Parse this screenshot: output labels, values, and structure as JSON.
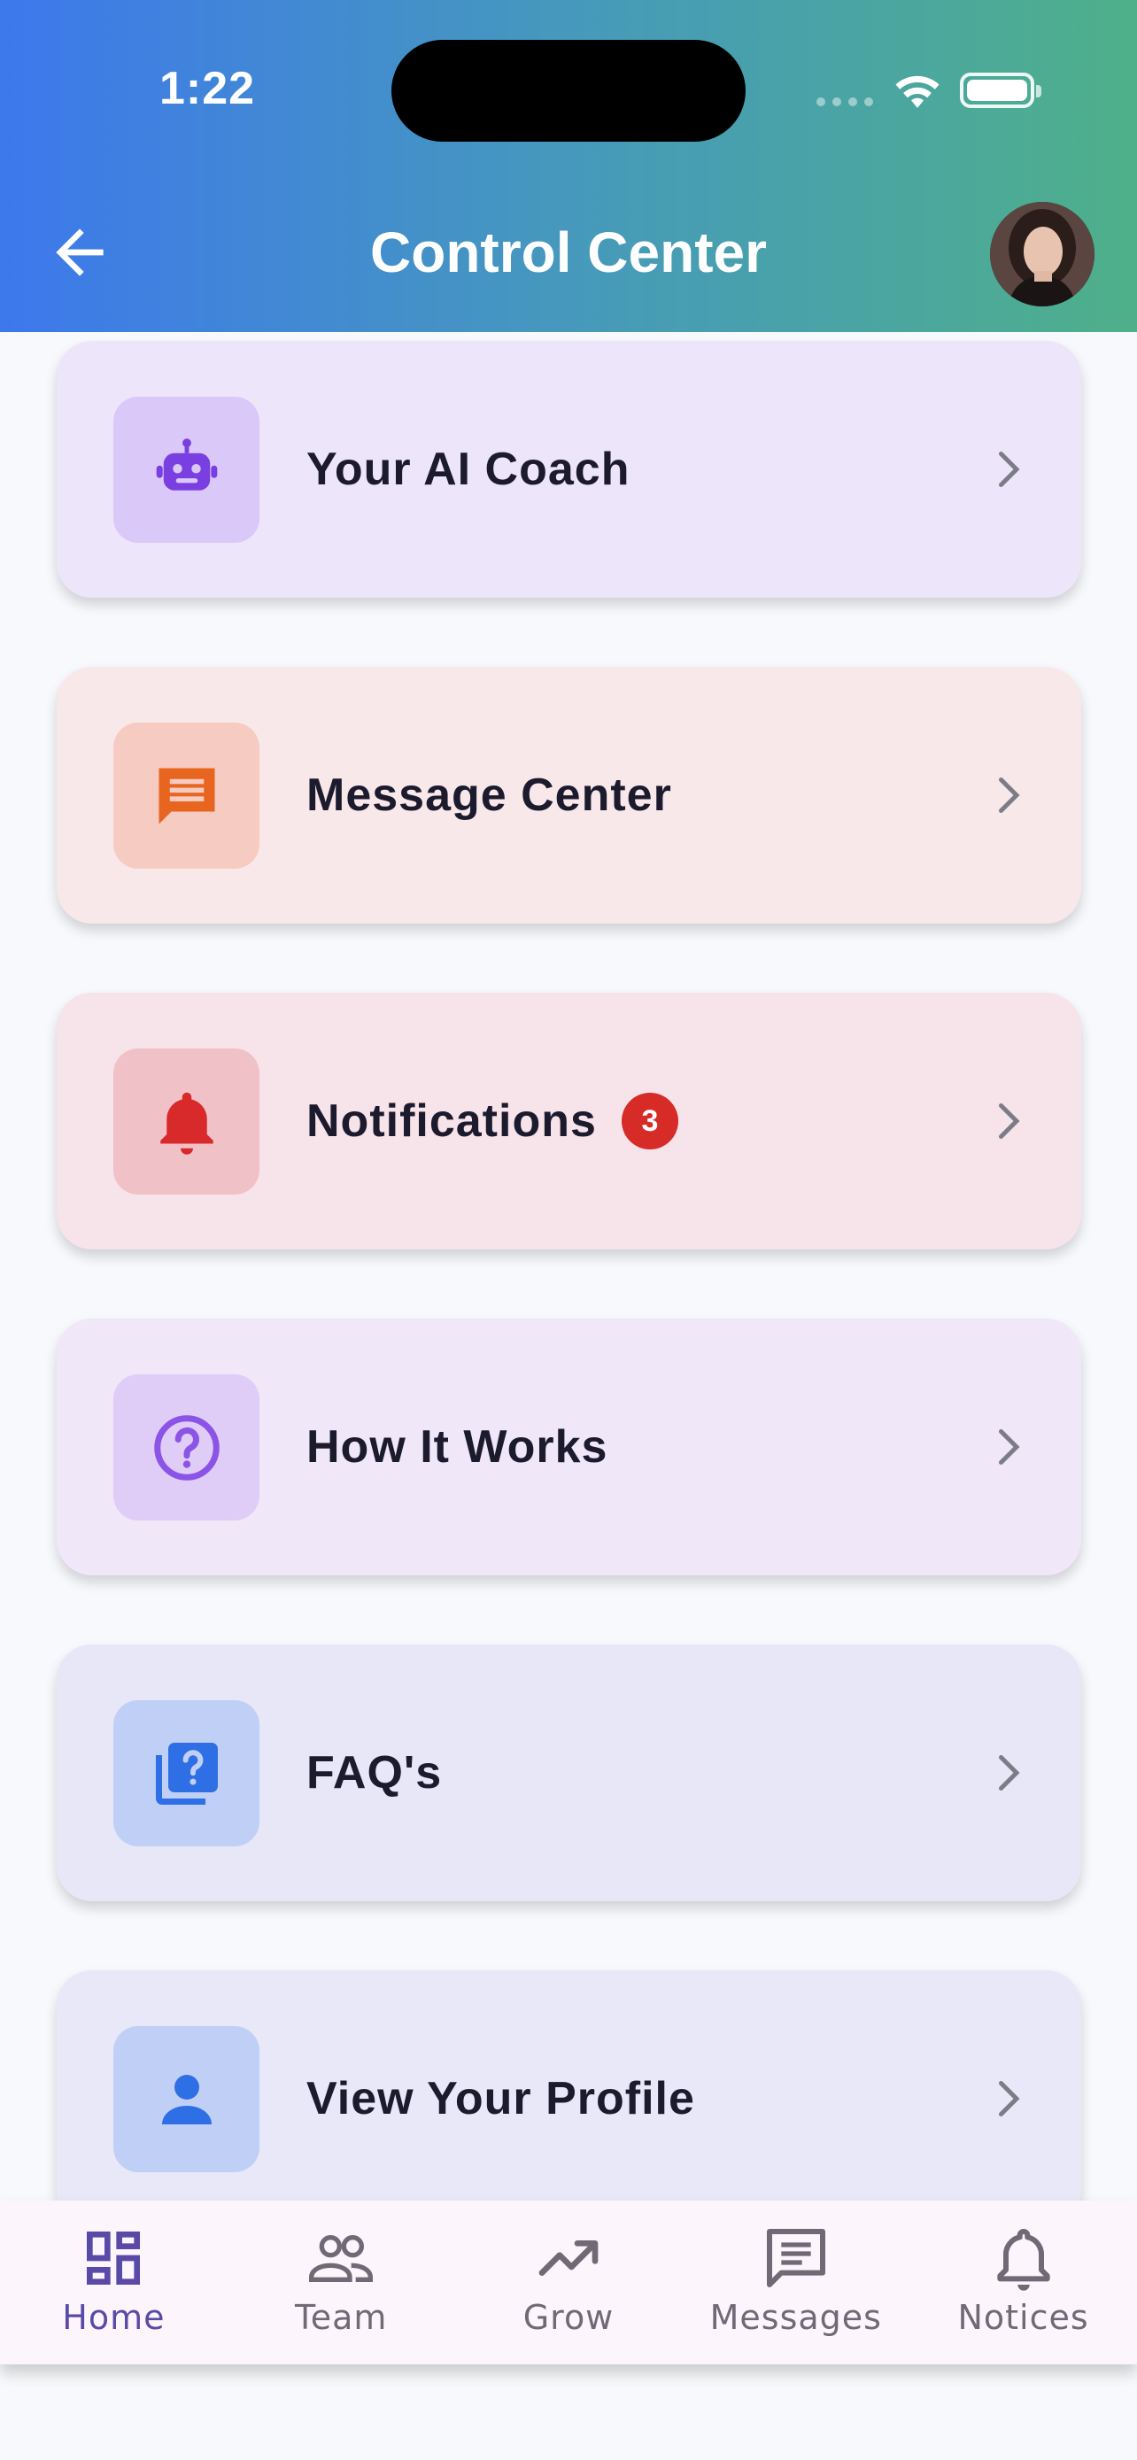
{
  "status_bar": {
    "time": "1:22"
  },
  "header": {
    "title": "Control Center"
  },
  "cards": [
    {
      "label": "Your AI Coach",
      "icon": "robot-icon",
      "bg": "#ede5f9",
      "icon_bg": "#d9c8f8",
      "icon_color": "#7a3fe0"
    },
    {
      "label": "Message Center",
      "icon": "chat-icon",
      "bg": "#f8e8ea",
      "icon_bg": "#f6cbc1",
      "icon_color": "#e8651f"
    },
    {
      "label": "Notifications",
      "badge": "3",
      "icon": "bell-icon",
      "bg": "#f7e3ea",
      "icon_bg": "#f1c1c8",
      "icon_color": "#d82a2a"
    },
    {
      "label": "How It Works",
      "icon": "help-circle-icon",
      "bg": "#f0e7f9",
      "icon_bg": "#dfcdf8",
      "icon_color": "#8b54e6"
    },
    {
      "label": "FAQ's",
      "icon": "faq-icon",
      "bg": "#e7e7f8",
      "icon_bg": "#c0cff5",
      "icon_color": "#2f6fe6"
    },
    {
      "label": "View Your Profile",
      "icon": "person-icon",
      "bg": "#e8e8f8",
      "icon_bg": "#c0cff5",
      "icon_color": "#2f6fe6"
    }
  ],
  "tabs": [
    {
      "label": "Home",
      "icon": "dashboard-icon",
      "active": true
    },
    {
      "label": "Team",
      "icon": "people-icon",
      "active": false
    },
    {
      "label": "Grow",
      "icon": "trending-up-icon",
      "active": false
    },
    {
      "label": "Messages",
      "icon": "message-icon",
      "active": false
    },
    {
      "label": "Notices",
      "icon": "bell-icon",
      "active": false
    }
  ]
}
